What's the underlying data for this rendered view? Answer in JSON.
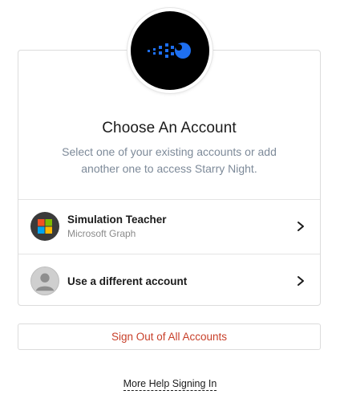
{
  "header": {
    "title": "Choose An Account",
    "subtitle": "Select one of your existing accounts or add another one to access Starry Night."
  },
  "accounts": [
    {
      "name": "Simulation Teacher",
      "provider": "Microsoft Graph",
      "icon": "microsoft-logo-icon"
    },
    {
      "name": "Use a different account",
      "icon": "generic-user-icon"
    }
  ],
  "actions": {
    "sign_out_all": "Sign Out of All Accounts",
    "help_link": "More Help Signing In"
  },
  "colors": {
    "brand_accent": "#1e6ff0",
    "danger_text": "#c8402a",
    "subtitle_text": "#7d8a99"
  }
}
